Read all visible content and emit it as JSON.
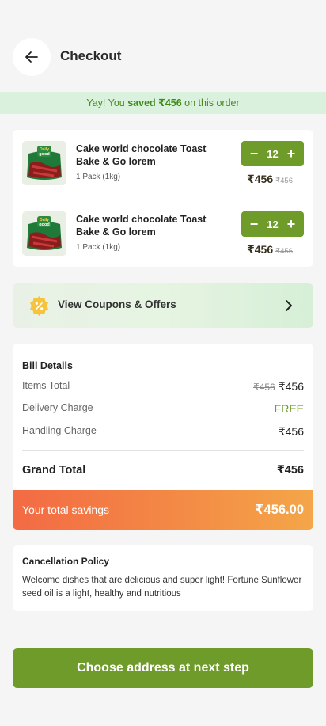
{
  "header": {
    "title": "Checkout",
    "back_icon": "arrow-left-icon"
  },
  "savings_banner": {
    "prefix": "Yay! You ",
    "bold": "saved ₹456",
    "suffix": " on this order"
  },
  "cart": {
    "items": [
      {
        "name": "Cake world chocolate Toast Bake & Go lorem",
        "pack": "1 Pack (1kg)",
        "qty": "12",
        "price": "₹456",
        "old_price": "₹456",
        "image_brand": "Daily good"
      },
      {
        "name": "Cake world chocolate Toast Bake & Go lorem",
        "pack": "1 Pack (1kg)",
        "qty": "12",
        "price": "₹456",
        "old_price": "₹456",
        "image_brand": "Daily good"
      }
    ]
  },
  "coupons": {
    "label": "View Coupons & Offers",
    "icon": "discount-badge-icon",
    "chevron": "chevron-right-icon"
  },
  "bill": {
    "heading": "Bill Details",
    "items_total": {
      "label": "Items Total",
      "old": "₹456",
      "value": "₹456"
    },
    "delivery": {
      "label": "Delivery Charge",
      "value": "FREE"
    },
    "handling": {
      "label": "Handling Charge",
      "value": "₹456"
    },
    "grand_total": {
      "label": "Grand Total",
      "value": "₹456"
    }
  },
  "savings": {
    "label": "Your total savings",
    "value": "₹456.00"
  },
  "policy": {
    "title": "Cancellation Policy",
    "text": "Welcome dishes that are delicious and super light! Fortune Sunflower seed oil is a light, healthy and nutritious"
  },
  "cta": {
    "label": "Choose address at next step"
  },
  "colors": {
    "primary": "#6e9b2a",
    "banner_bg": "#d9f1dd",
    "savings_start": "#f36a44",
    "savings_end": "#f4a649"
  }
}
